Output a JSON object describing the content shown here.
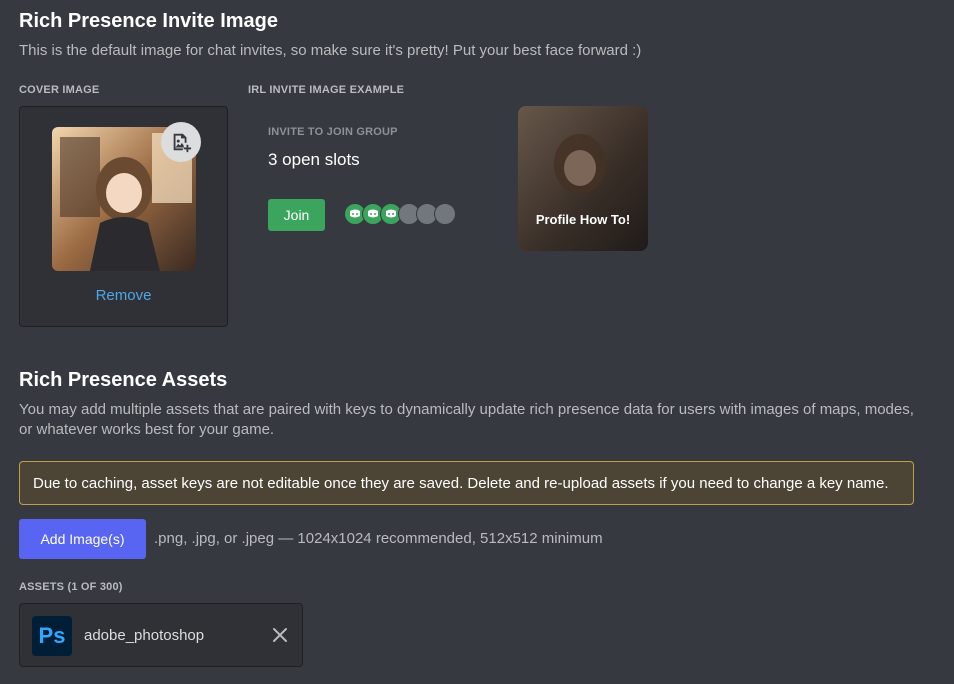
{
  "invite_section": {
    "title": "Rich Presence Invite Image",
    "description": "This is the default image for chat invites, so make sure it's pretty! Put your best face forward :)",
    "cover_label": "COVER IMAGE",
    "irl_label": "IRL INVITE IMAGE EXAMPLE",
    "remove_label": "Remove",
    "upload_icon": "image-add-icon"
  },
  "invite_example": {
    "eyebrow": "INVITE TO JOIN GROUP",
    "slots_text": "3 open slots",
    "join_label": "Join",
    "filled_avatars": 3,
    "empty_avatars": 3,
    "profile_caption": "Profile How To!"
  },
  "assets_section": {
    "title": "Rich Presence Assets",
    "description": "You may add multiple assets that are paired with keys to dynamically update rich presence data for users with images of maps, modes, or whatever works best for your game.",
    "warning": "Due to caching, asset keys are not editable once they are saved. Delete and re-upload assets if you need to change a key name.",
    "add_button": "Add Image(s)",
    "format_hint": ".png, .jpg, or .jpeg — 1024x1024 recommended, 512x512 minimum",
    "list_label": "ASSETS (1 OF 300)",
    "items": [
      {
        "icon_text": "Ps",
        "name": "adobe_photoshop",
        "icon": "photoshop-icon"
      }
    ]
  },
  "colors": {
    "background": "#36393f",
    "accent": "#5865f2",
    "join_green": "#3ba55d",
    "link_blue": "#4ea7e8",
    "warning_border": "#c59e4b"
  }
}
